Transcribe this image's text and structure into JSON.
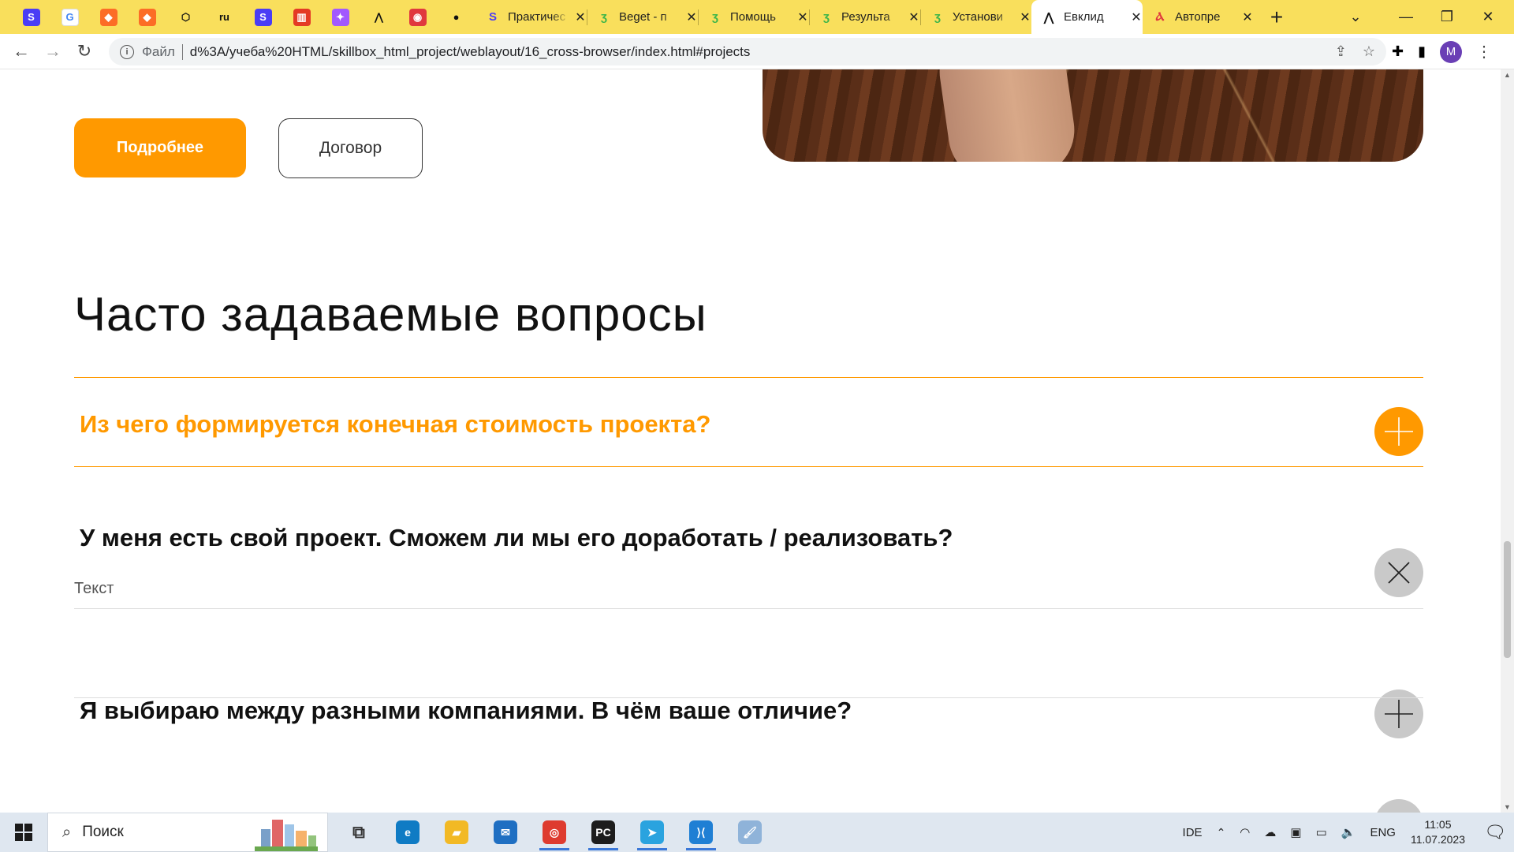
{
  "browser": {
    "pinned_tabs": [
      {
        "icon": "skillbox-icon",
        "glyph": "S",
        "color": "#4a3df5"
      },
      {
        "icon": "google-icon",
        "glyph": "G",
        "color": "#ffffff"
      },
      {
        "icon": "gitlab-icon",
        "glyph": "◆",
        "color": "#fc6d26"
      },
      {
        "icon": "gitlab-icon",
        "glyph": "◆",
        "color": "#fc6d26"
      },
      {
        "icon": "codepen-icon",
        "glyph": "⬡",
        "color": "#111111"
      },
      {
        "icon": "mailru-icon",
        "glyph": "ru",
        "color": "#111111"
      },
      {
        "icon": "skillbox-icon",
        "glyph": "S",
        "color": "#4a3df5"
      },
      {
        "icon": "html-academy-icon",
        "glyph": "▥",
        "color": "#e43a25"
      },
      {
        "icon": "figma-icon",
        "glyph": "✦",
        "color": "#a259ff"
      },
      {
        "icon": "euclid-icon",
        "glyph": "⋀",
        "color": "#111111"
      },
      {
        "icon": "colorpicker-icon",
        "glyph": "◉",
        "color": "#e0383e"
      },
      {
        "icon": "github-icon",
        "glyph": "●",
        "color": "#111111"
      }
    ],
    "tabs": [
      {
        "title": "Практичес",
        "favicon": "S",
        "favcolor": "#4a3df5",
        "active": false
      },
      {
        "title": "Beget - п",
        "favicon": "ʒ",
        "favcolor": "#3bb54a",
        "active": false
      },
      {
        "title": "Помощь",
        "favicon": "ʒ",
        "favcolor": "#3bb54a",
        "active": false
      },
      {
        "title": "Результа",
        "favicon": "ʒ",
        "favcolor": "#3bb54a",
        "active": false
      },
      {
        "title": "Установи",
        "favicon": "ʒ",
        "favcolor": "#3bb54a",
        "active": false
      },
      {
        "title": "Евклид",
        "favicon": "⋀",
        "favcolor": "#111111",
        "active": true
      },
      {
        "title": "Автопре",
        "favicon": "Ⲁ",
        "favcolor": "#e0383e",
        "active": false
      }
    ],
    "new_tab_label": "+",
    "omnibox": {
      "scheme": "Файл",
      "url": "d%3A/учеба%20HTML/skillbox_html_project/weblayout/16_cross-browser/index.html#projects"
    },
    "profile_initial": "M",
    "accent_color": "#f9df5c"
  },
  "page": {
    "buttons": {
      "more": "Подробнее",
      "contract": "Договор"
    },
    "faq": {
      "title": "Часто задаваемые вопросы",
      "items": [
        {
          "question": "Из чего формируется конечная стоимость проекта?",
          "state": "hover",
          "icon": "plus-icon"
        },
        {
          "question": "У меня есть свой проект. Сможем ли мы его доработать / реализовать?",
          "state": "open",
          "answer": "Текст",
          "icon": "close-icon"
        },
        {
          "question": "Я выбираю между разными компаниями. В чём ваше отличие?",
          "state": "closed",
          "icon": "plus-icon"
        }
      ]
    },
    "accent_color": "#ff9900"
  },
  "taskbar": {
    "search_placeholder": "Поиск",
    "apps": [
      {
        "icon": "task-view-icon",
        "glyph": "⧉",
        "color": "#333333"
      },
      {
        "icon": "edge-icon",
        "glyph": "e",
        "color": "#0f7bc4"
      },
      {
        "icon": "file-explorer-icon",
        "glyph": "▰",
        "color": "#f2b925"
      },
      {
        "icon": "mail-icon",
        "glyph": "✉",
        "color": "#1f6fc2"
      },
      {
        "icon": "chrome-icon",
        "glyph": "◎",
        "color": "#de3b2f",
        "running": true
      },
      {
        "icon": "pycharm-icon",
        "glyph": "PC",
        "color": "#1d1d1d",
        "running": true
      },
      {
        "icon": "telegram-icon",
        "glyph": "➤",
        "color": "#2aa3df",
        "running": true
      },
      {
        "icon": "vscode-icon",
        "glyph": "⟩⟨",
        "color": "#1f7fd4",
        "running": true
      },
      {
        "icon": "paint-icon",
        "glyph": "🖌",
        "color": "#8fb3d9"
      }
    ],
    "tray": {
      "ide_label": "IDE",
      "lang": "ENG",
      "time": "11:05",
      "date": "11.07.2023"
    }
  }
}
